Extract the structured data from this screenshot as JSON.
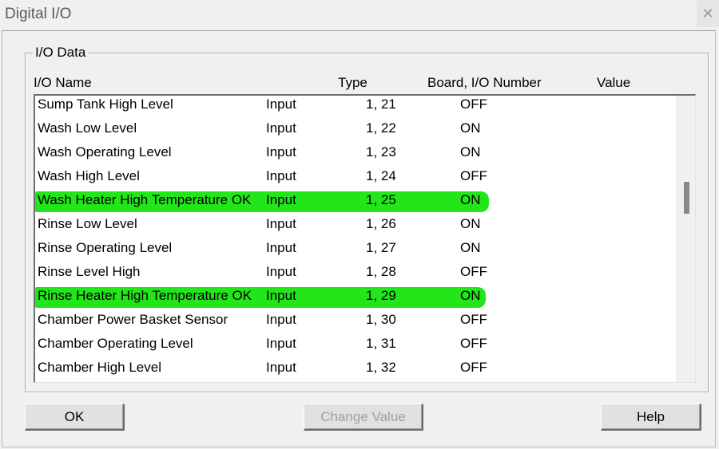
{
  "window": {
    "title": "Digital I/O",
    "close_glyph": "✕"
  },
  "group": {
    "label": "I/O Data"
  },
  "columns": {
    "name": "I/O Name",
    "type": "Type",
    "board": "Board, I/O Number",
    "value": "Value"
  },
  "rows": [
    {
      "name": "Sump Tank High Level",
      "type": "Input",
      "board": "1, 21",
      "value": "OFF",
      "highlight": false
    },
    {
      "name": "Wash Low Level",
      "type": "Input",
      "board": "1, 22",
      "value": "ON",
      "highlight": false
    },
    {
      "name": "Wash Operating Level",
      "type": "Input",
      "board": "1, 23",
      "value": "ON",
      "highlight": false
    },
    {
      "name": "Wash High Level",
      "type": "Input",
      "board": "1, 24",
      "value": "OFF",
      "highlight": false
    },
    {
      "name": "Wash Heater High Temperature OK",
      "type": "Input",
      "board": "1, 25",
      "value": "ON",
      "highlight": true
    },
    {
      "name": "Rinse Low Level",
      "type": "Input",
      "board": "1, 26",
      "value": "ON",
      "highlight": false
    },
    {
      "name": "Rinse Operating Level",
      "type": "Input",
      "board": "1, 27",
      "value": "ON",
      "highlight": false
    },
    {
      "name": "Rinse Level High",
      "type": "Input",
      "board": "1, 28",
      "value": "OFF",
      "highlight": false
    },
    {
      "name": "Rinse Heater High Temperature OK",
      "type": "Input",
      "board": "1, 29",
      "value": "ON",
      "highlight": true
    },
    {
      "name": "Chamber Power Basket Sensor",
      "type": "Input",
      "board": "1, 30",
      "value": "OFF",
      "highlight": false
    },
    {
      "name": "Chamber Operating Level",
      "type": "Input",
      "board": "1, 31",
      "value": "OFF",
      "highlight": false
    },
    {
      "name": "Chamber High Level",
      "type": "Input",
      "board": "1, 32",
      "value": "OFF",
      "highlight": false
    }
  ],
  "highlight_color": "#22e61a",
  "buttons": {
    "ok": "OK",
    "change_value": "Change Value",
    "help": "Help"
  }
}
